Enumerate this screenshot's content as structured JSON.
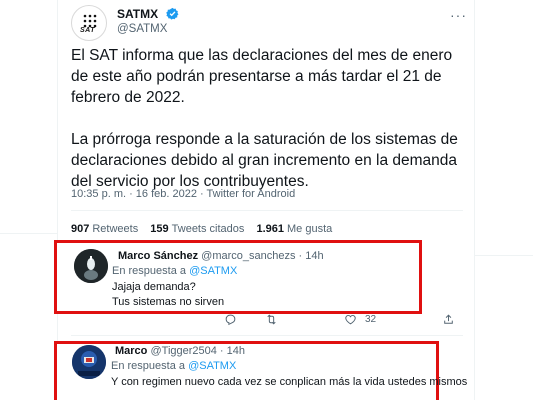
{
  "tweet": {
    "name": "SATMX",
    "handle": "@SATMX",
    "avatar_logo_text": "SAT",
    "paragraph1": "El SAT informa que las declaraciones del mes de enero de este año podrán presentarse a más tardar el 21 de febrero de 2022.",
    "paragraph2": "La prórroga responde a la saturación de los sistemas de declaraciones debido al gran incremento en la demanda del servicio por los contribuyentes.",
    "meta": "10:35 p. m. · 16 feb. 2022 · Twitter for Android",
    "stats": {
      "retweets_count": "907",
      "retweets_label": "Retweets",
      "quotes_count": "159",
      "quotes_label": "Tweets citados",
      "likes_count": "1.961",
      "likes_label": "Me gusta"
    }
  },
  "replies": [
    {
      "name": "Marco Sánchez",
      "handle": "@marco_sanchezs · 14h",
      "replying_prefix": "En respuesta a ",
      "replying_to": "@SATMX",
      "line1": "Jajaja demanda?",
      "line2": "Tus sistemas no sirven",
      "likes": "32"
    },
    {
      "name": "Marco",
      "handle": "@Tigger2504 · 14h",
      "replying_prefix": "En respuesta a ",
      "replying_to": "@SATMX",
      "line1": "Y con regimen nuevo cada vez se conplican más la vida ustedes mismos"
    }
  ],
  "icons": {
    "verified": "verified-badge-icon",
    "more": "more-options-icon",
    "reply": "reply-icon",
    "retweet": "retweet-icon",
    "like": "like-icon",
    "share": "share-icon"
  },
  "colors": {
    "highlight_border": "#e01010",
    "link": "#1d9bf0",
    "secondary_text": "#536471"
  }
}
